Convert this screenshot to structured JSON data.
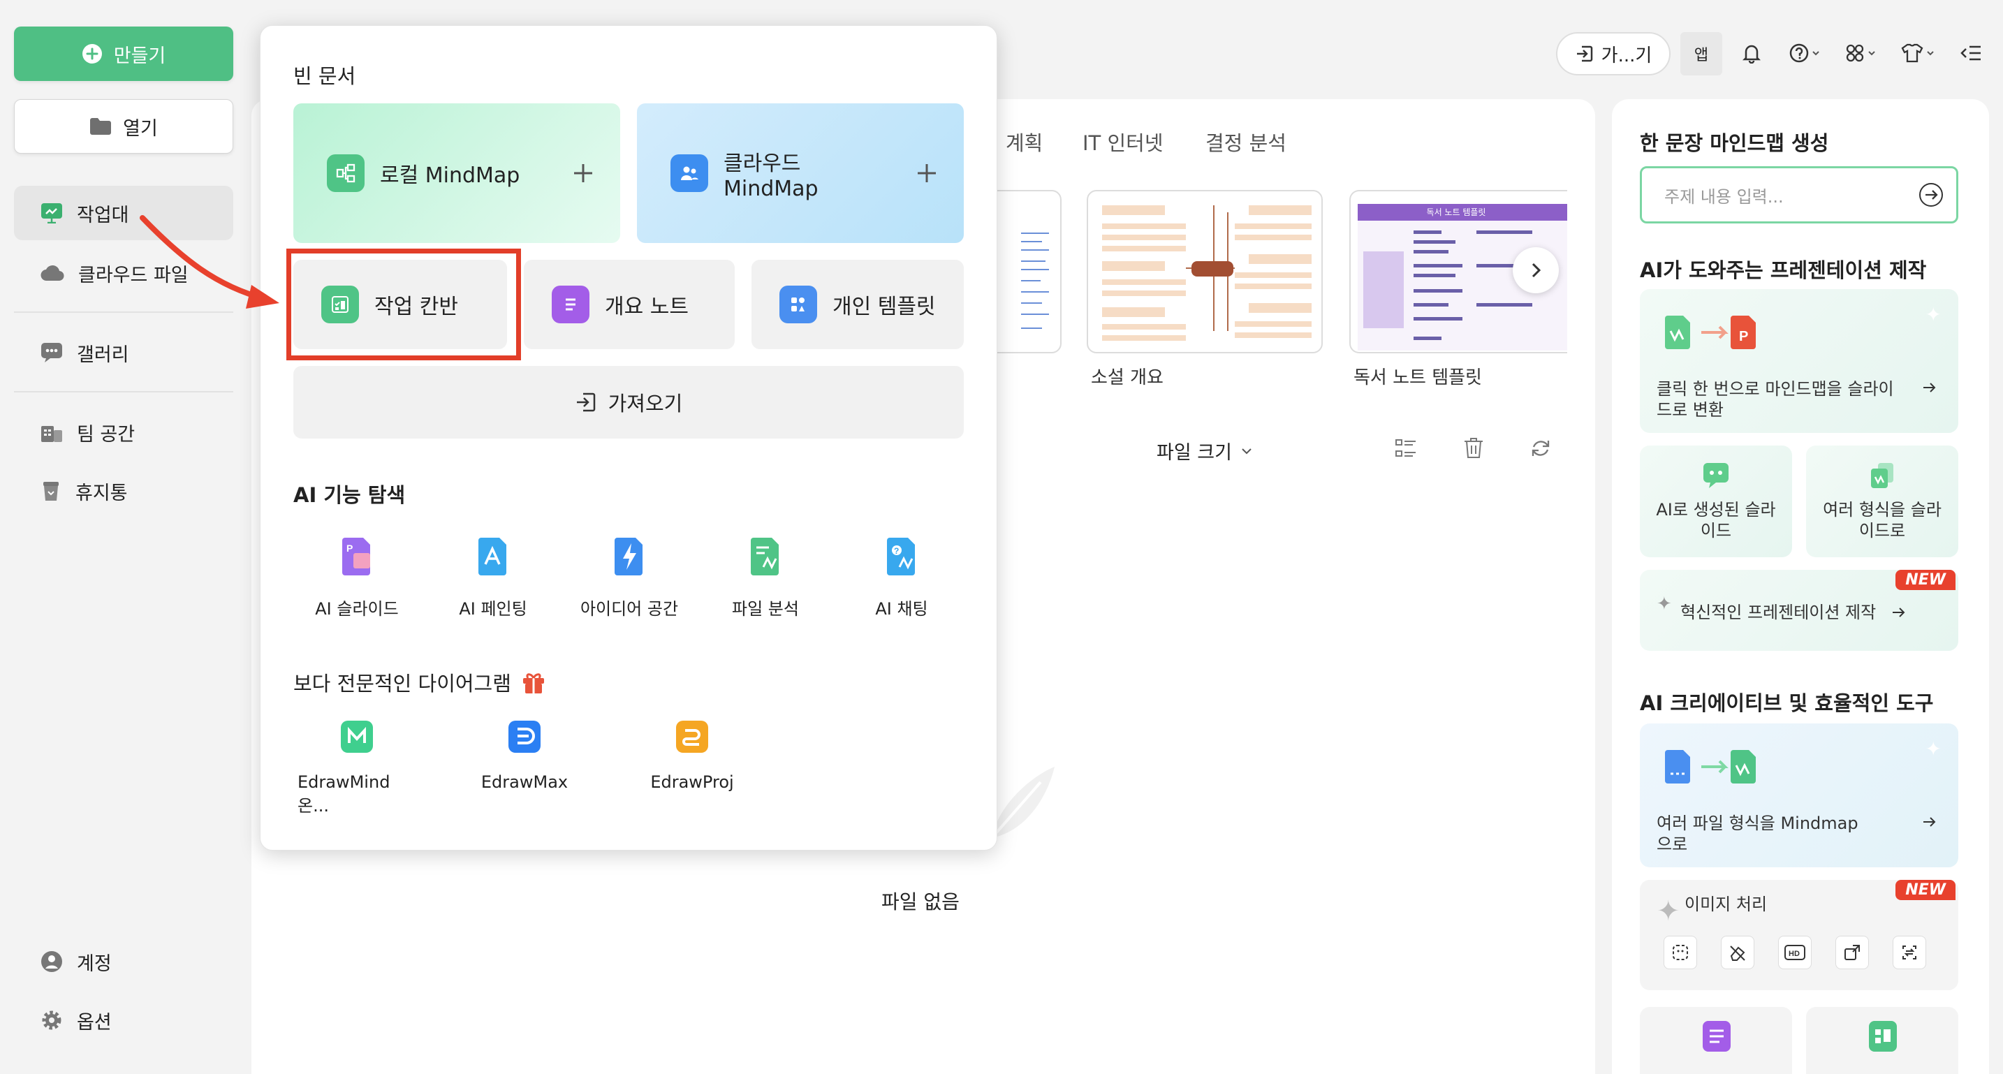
{
  "sidebar": {
    "create_label": "만들기",
    "open_label": "열기",
    "items": [
      {
        "label": "작업대"
      },
      {
        "label": "클라우드 파일"
      },
      {
        "label": "갤러리"
      },
      {
        "label": "팀 공간"
      },
      {
        "label": "휴지통"
      }
    ],
    "bottom": [
      {
        "label": "계정"
      },
      {
        "label": "옵션"
      }
    ]
  },
  "topbar": {
    "import_label": "가...기",
    "app_label": "앱"
  },
  "main": {
    "tabs": [
      "계획",
      "IT 인터넷",
      "결정 분석"
    ],
    "templates": [
      {
        "label": "소설 개요"
      },
      {
        "label": "독서 노트 템플릿"
      }
    ],
    "thumb_heading": "독서 노트 템플릿",
    "sort_label": "파일 크기",
    "empty_label": "파일 없음"
  },
  "popup": {
    "blank_title": "빈 문서",
    "local_mindmap": "로컬 MindMap",
    "cloud_mindmap": "클라우드 MindMap",
    "task_kanban": "작업 칸반",
    "outline_note": "개요 노트",
    "personal_template": "개인 템플릿",
    "import_label": "가져오기",
    "ai_title": "AI 기능 탐색",
    "ai_items": [
      {
        "label": "AI 슬라이드"
      },
      {
        "label": "AI 페인팅"
      },
      {
        "label": "아이디어 공간"
      },
      {
        "label": "파일 분석"
      },
      {
        "label": "AI 채팅"
      }
    ],
    "pro_title": "보다 전문적인 다이어그램",
    "pro_items": [
      {
        "label": "EdrawMind 온..."
      },
      {
        "label": "EdrawMax"
      },
      {
        "label": "EdrawProj"
      }
    ]
  },
  "right": {
    "one_sentence_title": "한 문장 마인드맵 생성",
    "topic_placeholder": "주제 내용 입력...",
    "ai_ppt_title": "AI가 도와주는 프레젠테이션 제작",
    "one_click_text": "클릭 한 번으로 마인드맵을 슬라이드로 변환",
    "ai_generated_slides": "AI로 생성된 슬라이드",
    "multi_format_slides": "여러 형식을 슬라이드로",
    "innovative_text": "혁신적인 프레젠테이션 제작",
    "new_badge": "NEW",
    "tools_title": "AI 크리에이티브 및 효율적인 도구",
    "multi_file_text": "여러 파일 형식을 Mindmap으로",
    "image_processing": "이미지 처리"
  },
  "colors": {
    "accent_green": "#4fbf84",
    "highlight_red": "#e8412d"
  }
}
